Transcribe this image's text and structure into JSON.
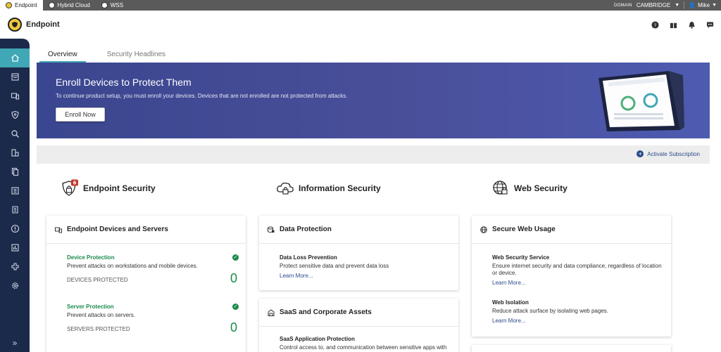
{
  "product_tabs": [
    {
      "label": "Endpoint",
      "active": true,
      "icon": "shield-icon"
    },
    {
      "label": "Hybrid Cloud",
      "active": false,
      "icon": "cloud-icon"
    },
    {
      "label": "WSS",
      "active": false,
      "icon": "web-icon"
    }
  ],
  "topbar": {
    "domain_label": "DOMAIN",
    "domain_value": "CAMBRIDGE",
    "user": "Mike"
  },
  "header": {
    "title": "Endpoint",
    "icons": [
      "help-icon",
      "gift-icon",
      "bell-icon",
      "chat-icon"
    ]
  },
  "sidebar": {
    "items": [
      "home-icon",
      "reports-icon",
      "devices-icon",
      "policies-icon",
      "search-icon",
      "assets-icon",
      "documents-icon",
      "inventory-icon",
      "logs-icon",
      "alerts-icon",
      "analytics-icon",
      "integrations-icon",
      "settings-icon"
    ],
    "active": "home-icon",
    "expand_label": "»"
  },
  "tabs": [
    {
      "label": "Overview",
      "active": true
    },
    {
      "label": "Security Headlines",
      "active": false
    }
  ],
  "banner": {
    "title": "Enroll Devices to Protect Them",
    "text": "To continue product setup, you must enroll your devices. Devices that are not enrolled are not protected from attacks.",
    "button": "Enroll Now"
  },
  "activate": {
    "label": "Activate Subscription"
  },
  "categories": {
    "endpoint": {
      "title": "Endpoint Security",
      "badge": "6"
    },
    "info": {
      "title": "Information Security"
    },
    "web": {
      "title": "Web Security"
    }
  },
  "cards": {
    "endpoint_devices": {
      "title": "Endpoint Devices and Servers",
      "device": {
        "name": "Device Protection",
        "desc": "Prevent attacks on workstations and mobile devices.",
        "stat_label": "DEVICES PROTECTED",
        "stat_value": "0"
      },
      "server": {
        "name": "Server Protection",
        "desc": "Prevent attacks on servers.",
        "stat_label": "SERVERS PROTECTED",
        "stat_value": "0"
      }
    },
    "data_protection": {
      "title": "Data Protection",
      "item": {
        "name": "Data Loss Prevention",
        "desc": "Protect sensitive data and prevent data loss",
        "link": "Learn More..."
      }
    },
    "saas": {
      "title": "SaaS and Corporate Assets",
      "item": {
        "name": "SaaS Application Protection",
        "desc": "Control access to, and communication between sensitive apps with"
      }
    },
    "web_usage": {
      "title": "Secure Web Usage",
      "wss": {
        "name": "Web Security Service",
        "desc": "Ensure internet security and data compliance, regardless of location or device.",
        "link": "Learn More..."
      },
      "isolation": {
        "name": "Web Isolation",
        "desc": "Reduce attack surface by isolating web pages.",
        "link": "Learn More..."
      }
    }
  }
}
